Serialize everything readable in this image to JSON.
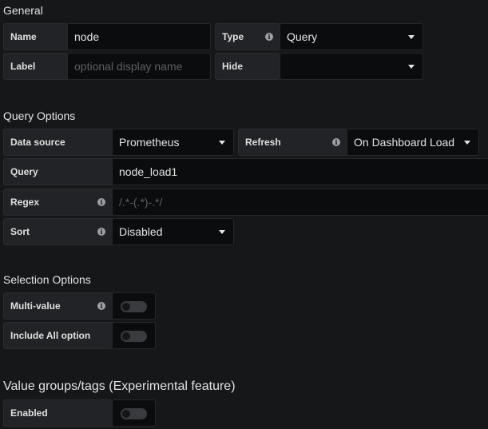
{
  "general": {
    "title": "General",
    "name_label": "Name",
    "name_value": "node",
    "type_label": "Type",
    "type_value": "Query",
    "label_label": "Label",
    "label_placeholder": "optional display name",
    "hide_label": "Hide",
    "hide_value": ""
  },
  "query_options": {
    "title": "Query Options",
    "datasource_label": "Data source",
    "datasource_value": "Prometheus",
    "refresh_label": "Refresh",
    "refresh_value": "On Dashboard Load",
    "query_label": "Query",
    "query_value": "node_load1",
    "regex_label": "Regex",
    "regex_placeholder": "/.*-(.*)-.*/",
    "sort_label": "Sort",
    "sort_value": "Disabled"
  },
  "selection_options": {
    "title": "Selection Options",
    "multi_value_label": "Multi-value",
    "multi_value_on": false,
    "include_all_label": "Include All option",
    "include_all_on": false
  },
  "value_groups": {
    "title": "Value groups/tags (Experimental feature)",
    "enabled_label": "Enabled",
    "enabled_on": false
  },
  "icons": {
    "info": "i"
  }
}
